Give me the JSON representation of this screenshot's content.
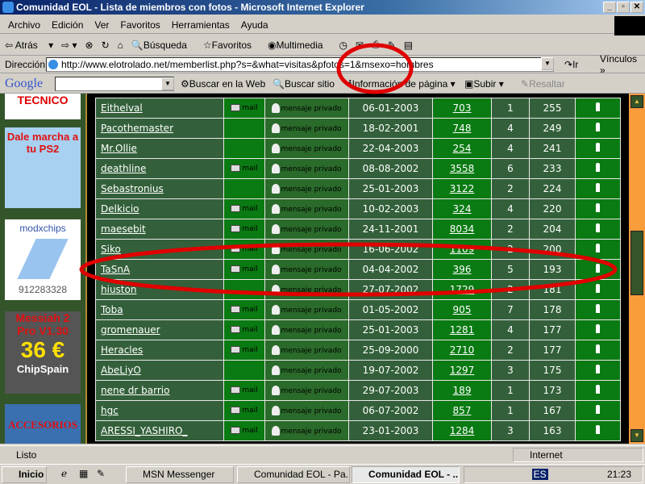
{
  "window": {
    "title": "Comunidad EOL - Lista de miembros con fotos - Microsoft Internet Explorer"
  },
  "menu": [
    "Archivo",
    "Edición",
    "Ver",
    "Favoritos",
    "Herramientas",
    "Ayuda"
  ],
  "toolbar": {
    "back": "Atrás",
    "search": "Búsqueda",
    "favorites": "Favoritos",
    "media": "Multimedia"
  },
  "address": {
    "label": "Dirección",
    "url": "http://www.elotrolado.net/memberlist.php?s=&what=visitas&pfotos=1&msexo=hombres",
    "go": "Ir",
    "links": "Vínculos"
  },
  "google": {
    "logo": "Google",
    "search_web": "Buscar en la Web",
    "search_site": "Buscar sitio",
    "page_info": "Información de página",
    "up": "Subir",
    "highlight": "Resaltar"
  },
  "sidebar_ads": [
    "TECNICO",
    "Dale marcha a tu PS2",
    "modxchips",
    "912283328",
    "Messiah 2 Pro V1.30",
    "36 €",
    "ChipSpain",
    "ACCESORIOS"
  ],
  "labels": {
    "mail": "mail",
    "pm": "mensaje privado"
  },
  "members": [
    {
      "name": "Eithelval",
      "mail": true,
      "date": "06-01-2003",
      "posts": "703",
      "rank": "1",
      "visits": "255"
    },
    {
      "name": "Pacothemaster",
      "mail": false,
      "date": "18-02-2001",
      "posts": "748",
      "rank": "4",
      "visits": "249"
    },
    {
      "name": "Mr.Ollie",
      "mail": false,
      "date": "22-04-2003",
      "posts": "254",
      "rank": "4",
      "visits": "241"
    },
    {
      "name": "deathline",
      "mail": true,
      "date": "08-08-2002",
      "posts": "3558",
      "rank": "6",
      "visits": "233"
    },
    {
      "name": "Sebastronius",
      "mail": false,
      "date": "25-01-2003",
      "posts": "3122",
      "rank": "2",
      "visits": "224"
    },
    {
      "name": "Delkicio",
      "mail": true,
      "date": "10-02-2003",
      "posts": "324",
      "rank": "4",
      "visits": "220"
    },
    {
      "name": "maesebit",
      "mail": true,
      "date": "24-11-2001",
      "posts": "8034",
      "rank": "2",
      "visits": "204"
    },
    {
      "name": "Siko",
      "mail": true,
      "date": "16-06-2002",
      "posts": "1109",
      "rank": "2",
      "visits": "200"
    },
    {
      "name": "TaSnA",
      "mail": true,
      "date": "04-04-2002",
      "posts": "396",
      "rank": "5",
      "visits": "193"
    },
    {
      "name": "hiuston",
      "mail": false,
      "date": "27-07-2002",
      "posts": "1729",
      "rank": "2",
      "visits": "181"
    },
    {
      "name": "Toba",
      "mail": true,
      "date": "01-05-2002",
      "posts": "905",
      "rank": "7",
      "visits": "178"
    },
    {
      "name": "gromenauer",
      "mail": true,
      "date": "25-01-2003",
      "posts": "1281",
      "rank": "4",
      "visits": "177"
    },
    {
      "name": "Heracles",
      "mail": true,
      "date": "25-09-2000",
      "posts": "2710",
      "rank": "2",
      "visits": "177"
    },
    {
      "name": "AbeLiyO",
      "mail": false,
      "date": "19-07-2002",
      "posts": "1297",
      "rank": "3",
      "visits": "175"
    },
    {
      "name": "nene dr barrio",
      "mail": true,
      "date": "29-07-2003",
      "posts": "189",
      "rank": "1",
      "visits": "173"
    },
    {
      "name": "hgc",
      "mail": true,
      "date": "06-07-2002",
      "posts": "857",
      "rank": "1",
      "visits": "167"
    },
    {
      "name": "ARESSI_YASHIRO_",
      "mail": true,
      "date": "23-01-2003",
      "posts": "1284",
      "rank": "3",
      "visits": "163"
    }
  ],
  "status": {
    "text": "Listo",
    "zone": "Internet"
  },
  "taskbar": {
    "start": "Inicio",
    "items": [
      "MSN Messenger",
      "Comunidad EOL - Pa...",
      "Comunidad EOL - ..."
    ],
    "clock": "21:23",
    "lang": "ES"
  },
  "colors": {
    "annotation": "#e00000",
    "table_dark": "#33603a",
    "table_bright": "#0a7a12",
    "scroll_track": "#f89c3c"
  }
}
